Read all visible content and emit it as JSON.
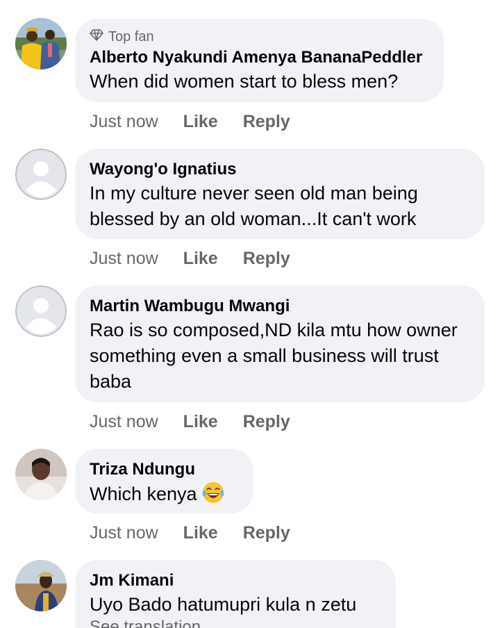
{
  "comments": [
    {
      "badge": "Top fan",
      "author": "Alberto Nyakundi Amenya BananaPeddler",
      "text": "When did women start to bless men?",
      "time": "Just now",
      "like": "Like",
      "reply": "Reply"
    },
    {
      "author": "Wayong'o Ignatius",
      "text": "In my culture never seen old man being blessed by an old woman...It can't work",
      "time": "Just now",
      "like": "Like",
      "reply": "Reply"
    },
    {
      "author": "Martin Wambugu Mwangi",
      "text": "Rao is so composed,ND kila mtu how owner something even a small business will trust baba",
      "time": "Just now",
      "like": "Like",
      "reply": "Reply"
    },
    {
      "author": "Triza Ndungu",
      "text": "Which kenya",
      "time": "Just now",
      "like": "Like",
      "reply": "Reply"
    },
    {
      "author": "Jm Kimani",
      "text": "Uyo Bado hatumupri kula n zetu",
      "see_translation": "See translation"
    }
  ],
  "colors": {
    "bubble": "#f0f2f5",
    "secondary_text": "#65676b",
    "primary_text": "#050505",
    "default_avatar": "#bcc0c4"
  },
  "icons": {
    "badge": "diamond-icon",
    "emoji": "tears-of-joy-emoji"
  }
}
